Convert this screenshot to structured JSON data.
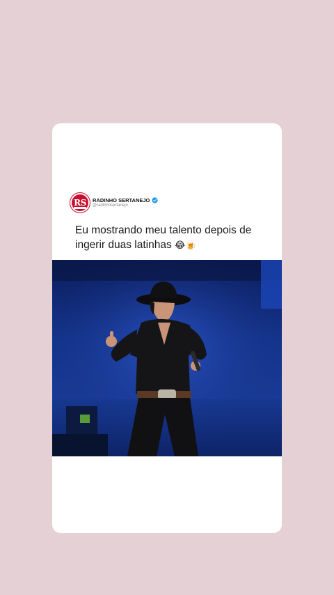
{
  "post": {
    "display_name": "RADINHO SERTANEJO",
    "handle": "@radinhosertanejo",
    "avatar_text": "RS",
    "text_line1": "Eu mostrando meu talento depois de",
    "text_line2": "ingerir duas latinhas",
    "emojis": "😂🍺"
  },
  "colors": {
    "background": "#e5d0d6",
    "card": "#ffffff",
    "brand": "#c8102e",
    "verified": "#1d9bf0"
  },
  "icons": {
    "verified": "verified-badge-icon",
    "avatar": "radinho-sertanejo-logo"
  }
}
